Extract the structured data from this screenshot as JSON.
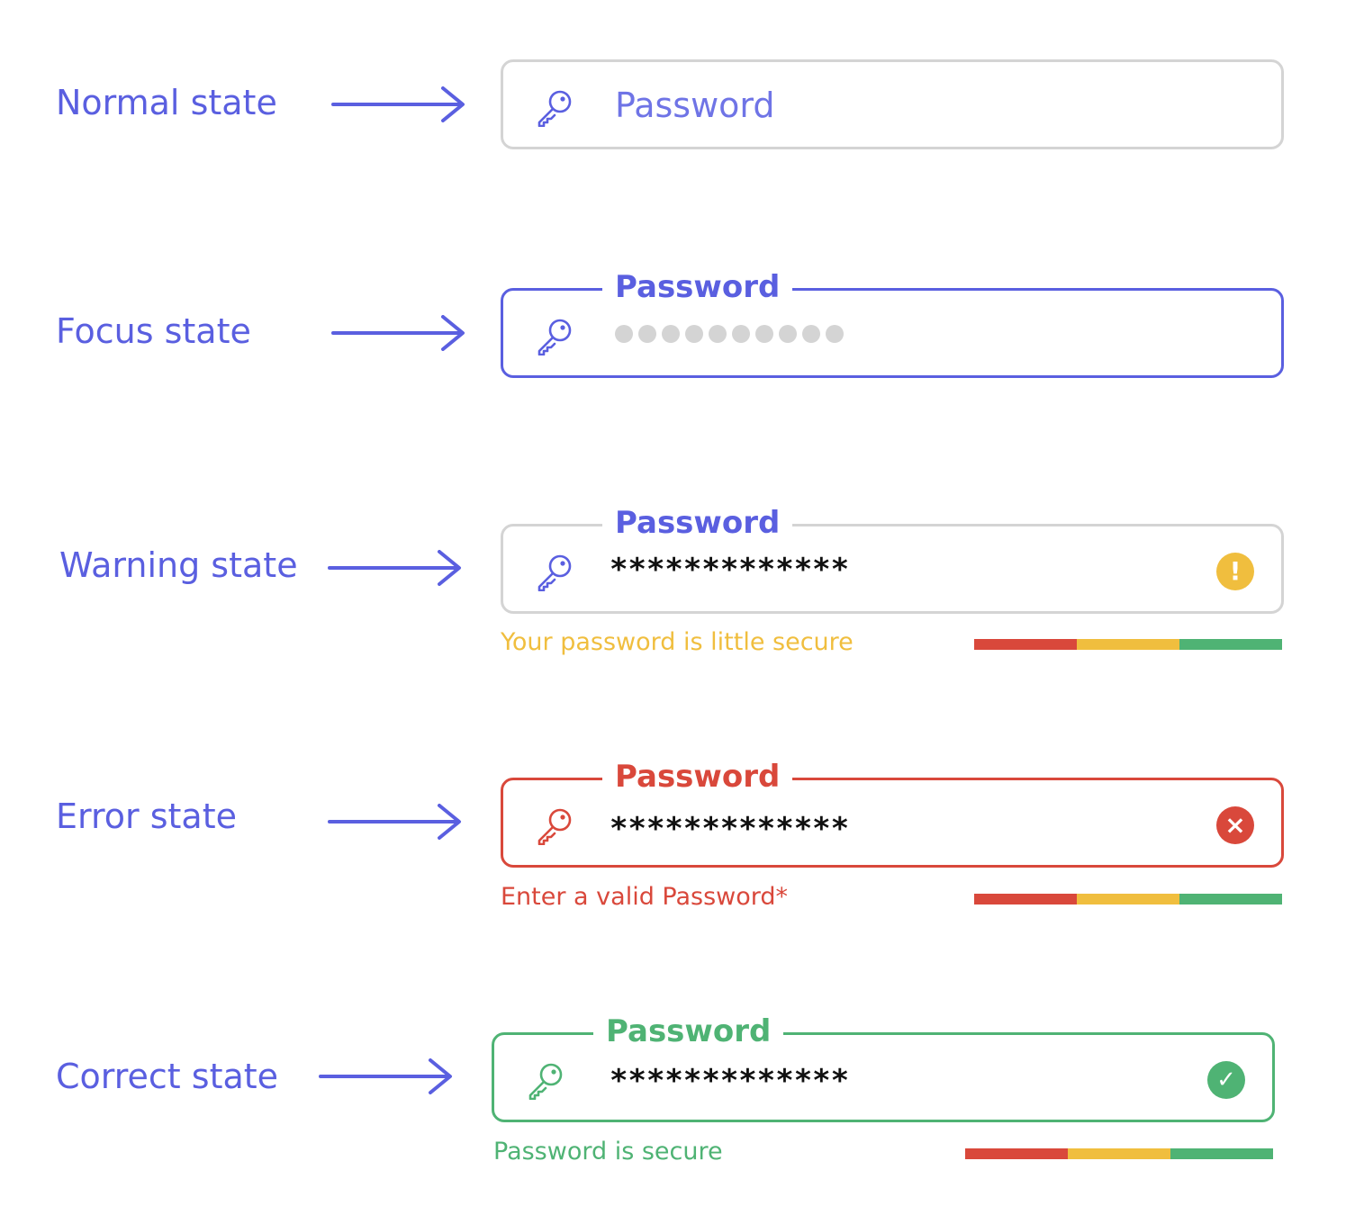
{
  "colors": {
    "brand": "#5a5fe0",
    "neutral_border": "#d4d4d4",
    "warning": "#f0be3e",
    "error": "#d9483b",
    "success": "#4fb374",
    "strength_weak": "#d9483b",
    "strength_medium": "#f0be3e",
    "strength_strong": "#4fb374"
  },
  "states": {
    "normal": {
      "label": "Normal state",
      "placeholder": "Password",
      "key_icon": "key-icon"
    },
    "focus": {
      "label": "Focus state",
      "field_label": "Password",
      "key_icon": "key-icon",
      "masked_dots": 10
    },
    "warning": {
      "label": "Warning state",
      "field_label": "Password",
      "value": "*************",
      "key_icon": "key-icon",
      "status_icon": "exclamation-icon",
      "status_glyph": "!",
      "helper": "Your password is little secure"
    },
    "error": {
      "label": "Error state",
      "field_label": "Password",
      "value": "*************",
      "key_icon": "key-icon",
      "status_icon": "close-icon",
      "status_glyph": "×",
      "helper": "Enter a valid Password*"
    },
    "correct": {
      "label": "Correct state",
      "field_label": "Password",
      "value": "*************",
      "key_icon": "key-icon",
      "status_icon": "check-icon",
      "status_glyph": "✓",
      "helper": "Password is secure"
    }
  }
}
